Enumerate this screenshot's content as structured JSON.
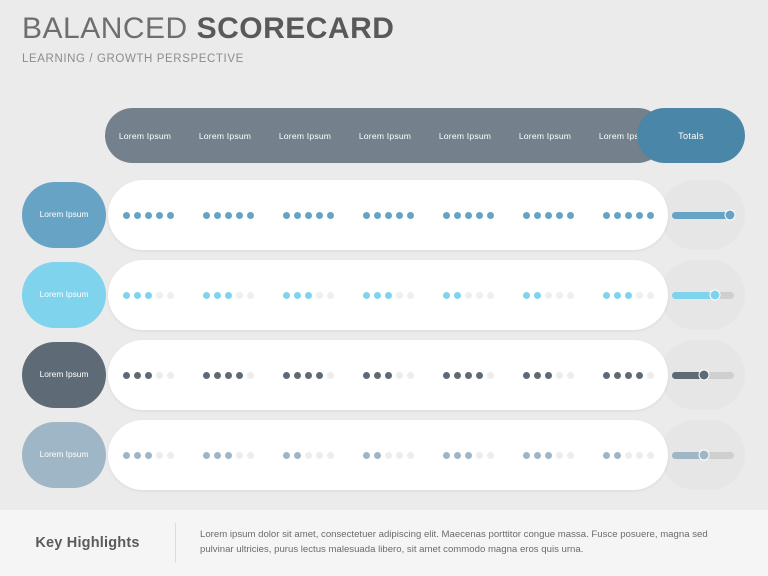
{
  "header": {
    "title_light": "BALANCED",
    "title_bold": "SCORECARD",
    "subtitle": "LEARNING / GROWTH PERSPECTIVE"
  },
  "columns": {
    "labels": [
      "Lorem Ipsum",
      "Lorem Ipsum",
      "Lorem Ipsum",
      "Lorem Ipsum",
      "Lorem Ipsum",
      "Lorem Ipsum",
      "Lorem Ipsum"
    ],
    "totals_label": "Totals",
    "header_color": "#74818c",
    "totals_color": "#4a86a8"
  },
  "rows": [
    {
      "label": "Lorem Ipsum",
      "color": "#67a3c4",
      "empty_color": "#ededed",
      "dots_total": 5,
      "ratings": [
        5,
        5,
        5,
        5,
        5,
        5,
        5
      ],
      "total_percent": 95
    },
    {
      "label": "Lorem Ipsum",
      "color": "#7fd3ed",
      "empty_color": "#efefef",
      "dots_total": 5,
      "ratings": [
        3,
        3,
        3,
        3,
        2,
        2,
        3
      ],
      "total_percent": 70
    },
    {
      "label": "Lorem Ipsum",
      "color": "#5e6b76",
      "empty_color": "#ededed",
      "dots_total": 5,
      "ratings": [
        3,
        4,
        4,
        3,
        4,
        3,
        4
      ],
      "total_percent": 52
    },
    {
      "label": "Lorem Ipsum",
      "color": "#9fb6c6",
      "empty_color": "#ededed",
      "dots_total": 5,
      "ratings": [
        3,
        3,
        2,
        2,
        3,
        3,
        2
      ],
      "total_percent": 52
    }
  ],
  "footer": {
    "title": "Key Highlights",
    "body": "Lorem ipsum dolor sit amet, consectetuer adipiscing elit. Maecenas porttitor congue massa. Fusce posuere, magna sed pulvinar ultricies, purus lectus malesuada libero, sit amet commodo magna eros quis urna."
  },
  "chart_data": {
    "type": "bar",
    "title": "BALANCED SCORECARD — LEARNING / GROWTH PERSPECTIVE",
    "xlabel": "",
    "ylabel": "",
    "categories": [
      "Lorem Ipsum",
      "Lorem Ipsum",
      "Lorem Ipsum",
      "Lorem Ipsum",
      "Lorem Ipsum",
      "Lorem Ipsum",
      "Lorem Ipsum"
    ],
    "scale_max": 5,
    "series": [
      {
        "name": "Lorem Ipsum",
        "values": [
          5,
          5,
          5,
          5,
          5,
          5,
          5
        ],
        "total_percent": 95,
        "color": "#67a3c4"
      },
      {
        "name": "Lorem Ipsum",
        "values": [
          3,
          3,
          3,
          3,
          2,
          2,
          3
        ],
        "total_percent": 70,
        "color": "#7fd3ed"
      },
      {
        "name": "Lorem Ipsum",
        "values": [
          3,
          4,
          4,
          3,
          4,
          3,
          4
        ],
        "total_percent": 52,
        "color": "#5e6b76"
      },
      {
        "name": "Lorem Ipsum",
        "values": [
          3,
          3,
          2,
          2,
          3,
          3,
          2
        ],
        "total_percent": 52,
        "color": "#9fb6c6"
      }
    ],
    "totals_column": "Totals",
    "grid": false,
    "legend": "left-row-labels"
  }
}
